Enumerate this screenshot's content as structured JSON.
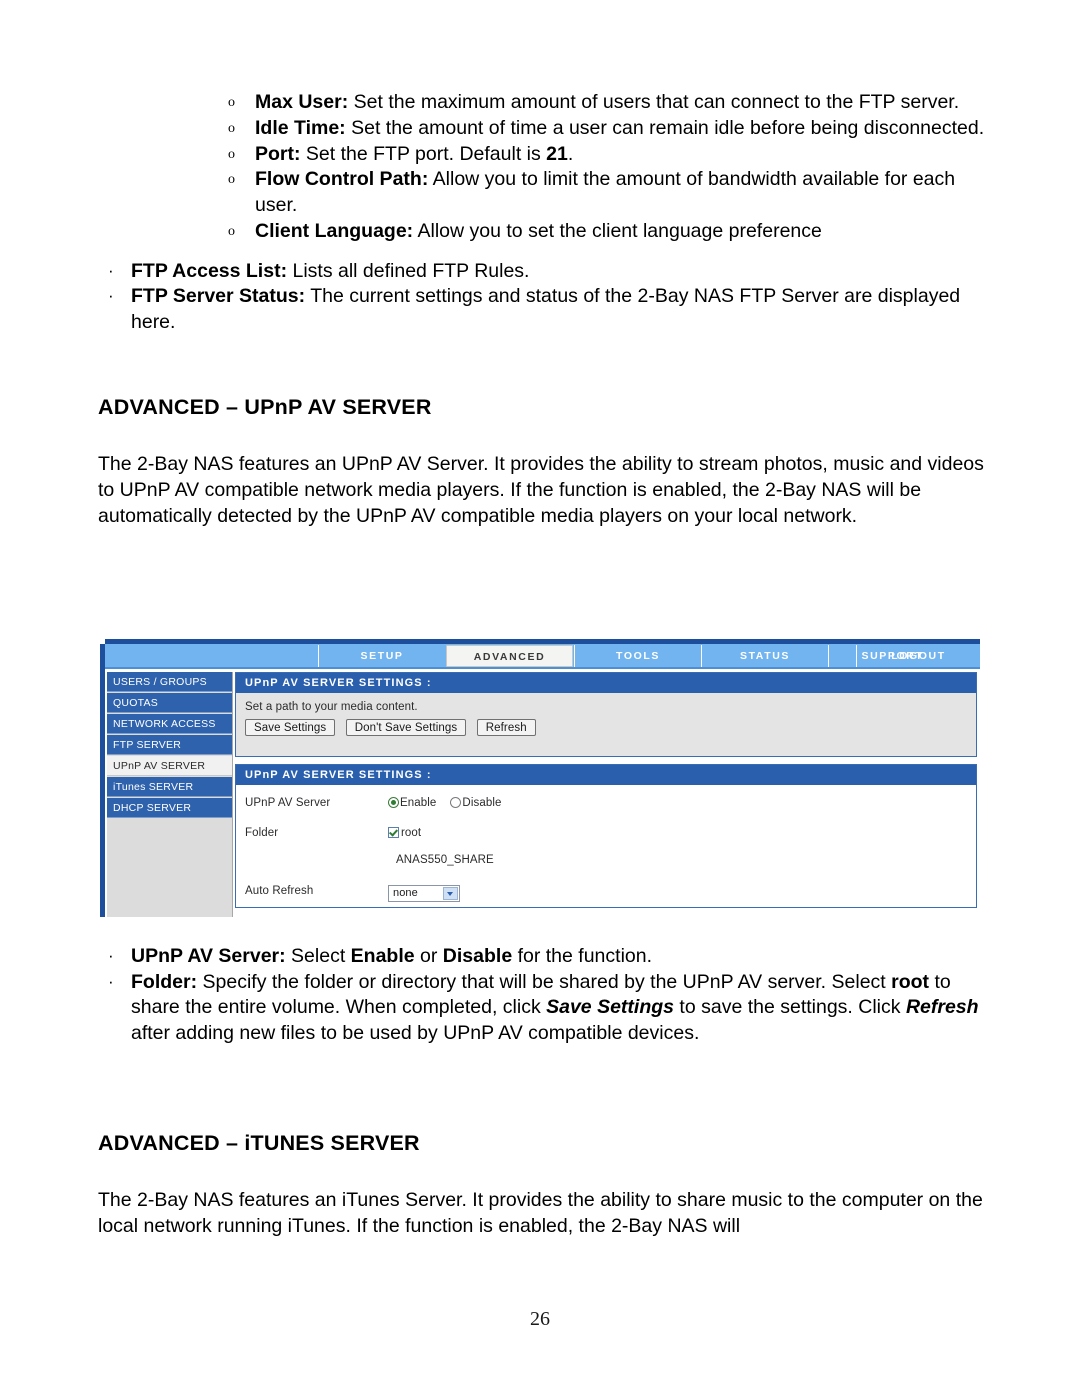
{
  "document": {
    "page_number": "26"
  },
  "ftp_sub_bullets": [
    {
      "marker": "o",
      "term": "Max User:",
      "text": " Set the maximum amount of users that can connect to the FTP server."
    },
    {
      "marker": "o",
      "term": "Idle Time:",
      "text": " Set the amount of time a user can remain idle before being disconnected."
    },
    {
      "marker": "o",
      "term": "Port:",
      "text": " Set the FTP port. Default is ",
      "bold_tail": "21",
      "tail": "."
    },
    {
      "marker": "o",
      "term": "Flow Control Path:",
      "text": " Allow you to limit the amount of bandwidth available for each user."
    },
    {
      "marker": "o",
      "term": "Client Language:",
      "text": " Allow you to set the client language preference"
    }
  ],
  "ftp_bullets": [
    {
      "marker": "·",
      "term": "FTP Access List:",
      "text": " Lists all defined FTP Rules."
    },
    {
      "marker": "·",
      "term": "FTP Server Status:",
      "text": " The current settings and status of the 2-Bay NAS FTP Server are displayed here."
    }
  ],
  "upnp_section": {
    "heading": "ADVANCED – UPnP AV SERVER",
    "paragraph": "The 2-Bay NAS features an UPnP AV Server. It provides the ability to stream photos, music and videos to UPnP AV compatible network media players. If the function is enabled, the 2-Bay NAS will be automatically detected by the UPnP AV compatible media players on your local network."
  },
  "upnp_bullets": {
    "server": {
      "marker": "·",
      "term": "UPnP AV Server:",
      "part1": " Select ",
      "enable": "Enable",
      "part2": " or ",
      "disable": "Disable",
      "part3": " for the function."
    },
    "folder": {
      "marker": "·",
      "term": "Folder:",
      "part1": " Specify the folder or directory that will be shared by the UPnP AV server. Select ",
      "root": "root",
      "part2": " to share the entire volume. When completed, click ",
      "save_settings": "Save Settings",
      "part3": " to save the settings. Click ",
      "refresh": "Refresh",
      "part4": " after adding new files to be used by UPnP AV compatible devices."
    }
  },
  "itunes_section": {
    "heading": "ADVANCED – iTUNES SERVER",
    "paragraph": "The 2-Bay NAS features an iTunes Server. It provides the ability to share music to the computer on the local network running iTunes. If the function is enabled, the 2-Bay NAS will"
  },
  "screenshot": {
    "nav_tabs": [
      {
        "label": "SETUP",
        "active": false
      },
      {
        "label": "ADVANCED",
        "active": true
      },
      {
        "label": "TOOLS",
        "active": false
      },
      {
        "label": "STATUS",
        "active": false
      },
      {
        "label": "SUPPORT",
        "active": false
      },
      {
        "label": "LOGOUT",
        "active": false
      }
    ],
    "sidebar_items": [
      {
        "label": "USERS / GROUPS",
        "active": false
      },
      {
        "label": "QUOTAS",
        "active": false
      },
      {
        "label": "NETWORK ACCESS",
        "active": false
      },
      {
        "label": "FTP SERVER",
        "active": false
      },
      {
        "label": "UPnP AV SERVER",
        "active": true
      },
      {
        "label": "iTunes SERVER",
        "active": false
      },
      {
        "label": "DHCP SERVER",
        "active": false
      }
    ],
    "panel1": {
      "title": "UPnP AV SERVER SETTINGS :",
      "description": "Set a path to your media content.",
      "buttons": [
        {
          "label": "Save Settings"
        },
        {
          "label": "Don't Save Settings"
        },
        {
          "label": "Refresh"
        }
      ]
    },
    "panel2": {
      "title": "UPnP AV SERVER SETTINGS :",
      "rows": {
        "server": {
          "label": "UPnP AV Server",
          "enable_label": "Enable",
          "disable_label": "Disable",
          "selected": "Enable"
        },
        "folder": {
          "label": "Folder",
          "root_label": "root",
          "root_checked": true,
          "share_name": "ANAS550_SHARE"
        },
        "auto_refresh": {
          "label": "Auto Refresh",
          "value": "none"
        }
      }
    },
    "colors": {
      "nav_bg": "#72b4ef",
      "panel_header": "#2a5fae",
      "sidebar_item": "#2f62ad",
      "accent_border": "#1d4f9c"
    }
  }
}
